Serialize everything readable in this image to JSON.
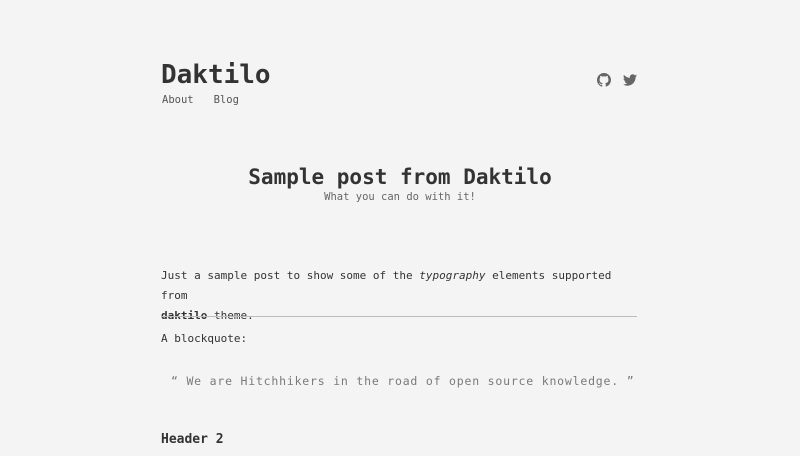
{
  "site": {
    "title": "Daktilo",
    "nav": [
      {
        "label": "About"
      },
      {
        "label": "Blog"
      }
    ],
    "social": [
      "github-icon",
      "twitter-icon"
    ]
  },
  "post": {
    "title": "Sample post from Daktilo",
    "subtitle": "What you can do with it!",
    "intro": {
      "part1": "Just a sample post to show some of the ",
      "em": "typography",
      "part2": " elements supported from",
      "strong": "daktilo",
      "part3": " theme."
    },
    "blockquote_label": "A blockquote:",
    "blockquote": "“ We are Hitchhikers in the road of open source knowledge. ”",
    "header2": "Header 2"
  },
  "colors": {
    "background": "#f4f4f4",
    "text": "#333333",
    "muted": "#7a7a7a"
  }
}
